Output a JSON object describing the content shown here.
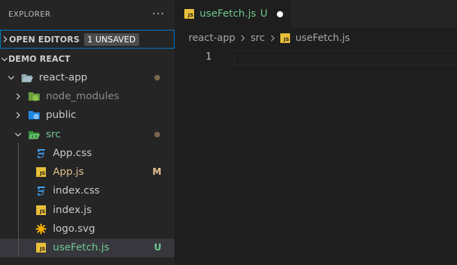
{
  "sidebar": {
    "title": "EXPLORER",
    "more": "···",
    "open_editors": {
      "label": "OPEN EDITORS",
      "badge": "1 UNSAVED"
    },
    "project": {
      "label": "DEMO REACT"
    },
    "tree": [
      {
        "label": "react-app",
        "type": "folder",
        "expanded": true,
        "decoration": "dot"
      },
      {
        "label": "node_modules",
        "type": "folder",
        "expanded": false,
        "dim": true
      },
      {
        "label": "public",
        "type": "folder",
        "expanded": false
      },
      {
        "label": "src",
        "type": "folder",
        "expanded": true,
        "decoration": "dot",
        "color": "green"
      },
      {
        "label": "App.css",
        "type": "css"
      },
      {
        "label": "App.js",
        "type": "js",
        "decoration": "M",
        "color": "modified"
      },
      {
        "label": "index.css",
        "type": "css"
      },
      {
        "label": "index.js",
        "type": "js"
      },
      {
        "label": "logo.svg",
        "type": "svg"
      },
      {
        "label": "useFetch.js",
        "type": "js",
        "decoration": "U",
        "color": "green",
        "selected": true
      }
    ]
  },
  "editor": {
    "tab": {
      "label": "useFetch.js",
      "status": "U",
      "icon": "js-file-icon"
    },
    "breadcrumb": [
      "react-app",
      "src",
      "useFetch.js"
    ],
    "lines": [
      {
        "number": "1",
        "text": ""
      }
    ]
  },
  "colors": {
    "untracked": "#73c991",
    "modified": "#e2c08d",
    "focus_border": "#007fd4",
    "js_icon": "#e8bf3a",
    "css_icon": "#42a5f5"
  }
}
